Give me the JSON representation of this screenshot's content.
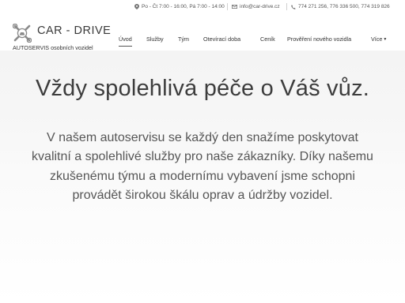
{
  "topbar": {
    "hours": "Po - Čt 7:00 - 16:00, Pá 7:00 - 14:00",
    "email": "info@car-drive.cz",
    "phones": "774 271 256, 776 336 500, 774 319 826"
  },
  "brand": {
    "name": "CAR - DRIVE",
    "tagline": "AUTOSERVIS osobních vozidel"
  },
  "nav": {
    "items": [
      "Úvod",
      "Služby",
      "Tým",
      "Otevírací doba",
      "Ceník",
      "Prověření nového vozidla",
      "Více"
    ],
    "active": "Úvod"
  },
  "hero": {
    "title": "Vždy spolehlivá péče o Váš vůz.",
    "lines": [
      "V našem autoservisu se každý den snažíme poskytovat",
      "kvalitní a spolehlivé služby pro naše zákazníky. Díky našemu",
      "zkušenému týmu a modernímu vybavení jsme schopni",
      "provádět širokou škálu oprav a údržby vozidel."
    ]
  },
  "colors": {
    "text": "#4a4a4a",
    "hero_band": "#f4f4f4"
  }
}
